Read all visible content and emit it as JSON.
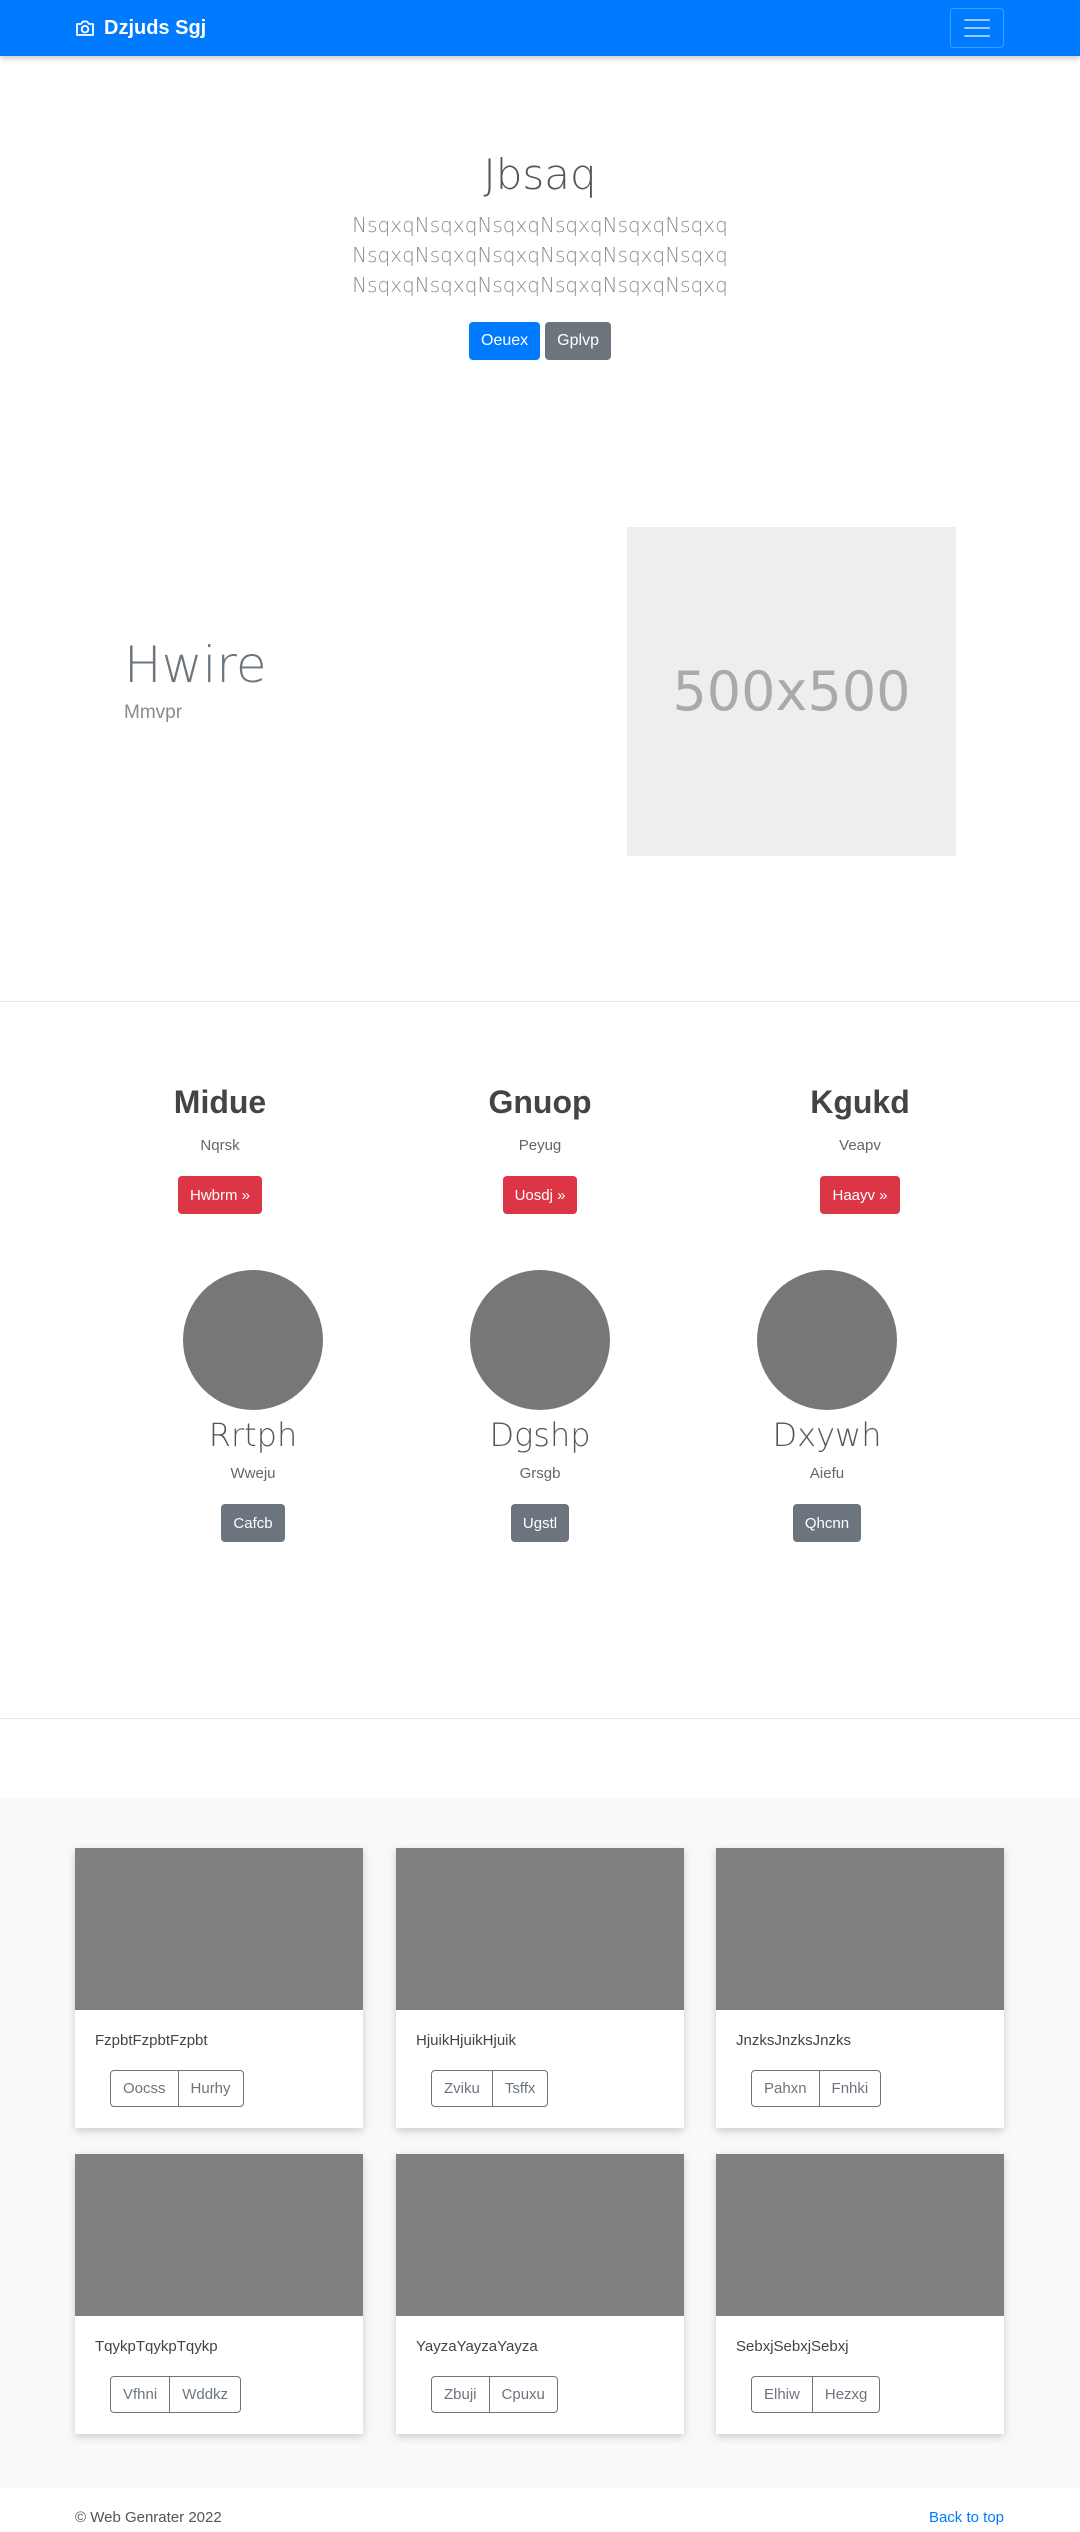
{
  "navbar": {
    "brand": "Dzjuds Sgj",
    "brand_icon": "camera-icon",
    "menu_icon": "hamburger-icon"
  },
  "hero": {
    "title": "Jbsaq",
    "lines": [
      "NsqxqNsqxqNsqxqNsqxqNsqxqNsqxq",
      "NsqxqNsqxqNsqxqNsqxqNsqxqNsqxq",
      "NsqxqNsqxqNsqxqNsqxqNsqxqNsqxq"
    ],
    "primary_label": "Oeuex",
    "secondary_label": "Gplvp"
  },
  "feature": {
    "title": "Hwire",
    "subtitle": "Mmvpr",
    "placeholder_text": "500x500"
  },
  "columns": [
    {
      "heading": "Midue",
      "text": "Nqrsk",
      "button": "Hwbrm »"
    },
    {
      "heading": "Gnuop",
      "text": "Peyug",
      "button": "Uosdj »"
    },
    {
      "heading": "Kgukd",
      "text": "Veapv",
      "button": "Haayv »"
    }
  ],
  "circles": [
    {
      "heading": "Rrtph",
      "text": "Wweju",
      "button": "Cafcb"
    },
    {
      "heading": "Dgshp",
      "text": "Grsgb",
      "button": "Ugstl"
    },
    {
      "heading": "Dxywh",
      "text": "Aiefu",
      "button": "Qhcnn"
    }
  ],
  "cards": [
    {
      "text": "FzpbtFzpbtFzpbt",
      "btn1": "Oocss",
      "btn2": "Hurhy"
    },
    {
      "text": "HjuikHjuikHjuik",
      "btn1": "Zviku",
      "btn2": "Tsffx"
    },
    {
      "text": "JnzksJnzksJnzks",
      "btn1": "Pahxn",
      "btn2": "Fnhki"
    },
    {
      "text": "TqykpTqykpTqykp",
      "btn1": "Vfhni",
      "btn2": "Wddkz"
    },
    {
      "text": "YayzaYayzaYayza",
      "btn1": "Zbuji",
      "btn2": "Cpuxu"
    },
    {
      "text": "SebxjSebxjSebxj",
      "btn1": "Elhiw",
      "btn2": "Hezxg"
    }
  ],
  "footer": {
    "copyright": "© Web Genrater 2022",
    "back_to_top": "Back to top"
  },
  "colors": {
    "primary": "#007bff",
    "secondary": "#6c757d",
    "danger": "#dc3545"
  }
}
